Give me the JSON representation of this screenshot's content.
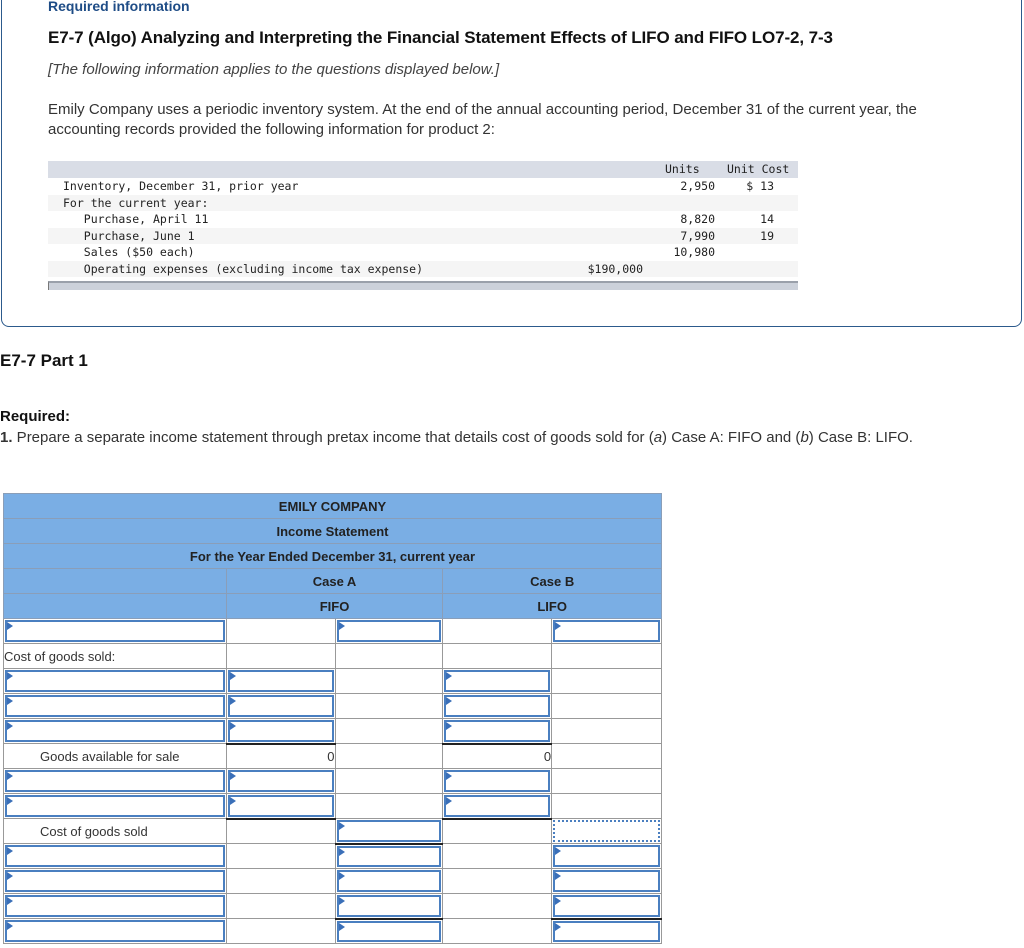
{
  "header": {
    "required_info": "Required information",
    "title": "E7-7 (Algo) Analyzing and Interpreting the Financial Statement Effects of LIFO and FIFO LO7-2, 7-3",
    "subtitle": "[The following information applies to the questions displayed below.]",
    "intro": "Emily Company uses a periodic inventory system. At the end of the annual accounting period, December 31 of the current year, the accounting records provided the following information for product 2:"
  },
  "info_table": {
    "columns": {
      "units": "Units",
      "unit_cost": "Unit Cost"
    },
    "rows": [
      {
        "label": "Inventory, December 31, prior year",
        "amount": "",
        "units": "2,950",
        "unit_cost": "$ 13"
      },
      {
        "label": "For the current year:",
        "amount": "",
        "units": "",
        "unit_cost": ""
      },
      {
        "label": "   Purchase, April 11",
        "amount": "",
        "units": "8,820",
        "unit_cost": "14"
      },
      {
        "label": "   Purchase, June 1",
        "amount": "",
        "units": "7,990",
        "unit_cost": "19"
      },
      {
        "label": "   Sales ($50 each)",
        "amount": "",
        "units": "10,980",
        "unit_cost": ""
      },
      {
        "label": "   Operating expenses (excluding income tax expense)",
        "amount": "$190,000",
        "units": "",
        "unit_cost": ""
      }
    ]
  },
  "part": {
    "title": "E7-7 Part 1",
    "required_label": "Required:",
    "required_number": "1.",
    "required_text_1": " Prepare a separate income statement through pretax income that details cost of goods sold for (",
    "a": "a",
    "required_text_2": ") Case A: FIFO and (",
    "b": "b",
    "required_text_3": ") Case B: LIFO."
  },
  "income_statement": {
    "company": "EMILY COMPANY",
    "statement": "Income Statement",
    "period": "For the Year Ended December 31, current year",
    "case_a": "Case A",
    "case_b": "Case B",
    "method_a": "FIFO",
    "method_b": "LIFO",
    "cogs_header": "Cost of goods sold:",
    "goods_available_label": "Goods available for sale",
    "goods_available_a": "0",
    "goods_available_b": "0",
    "cogs_label": "Cost of goods sold"
  }
}
